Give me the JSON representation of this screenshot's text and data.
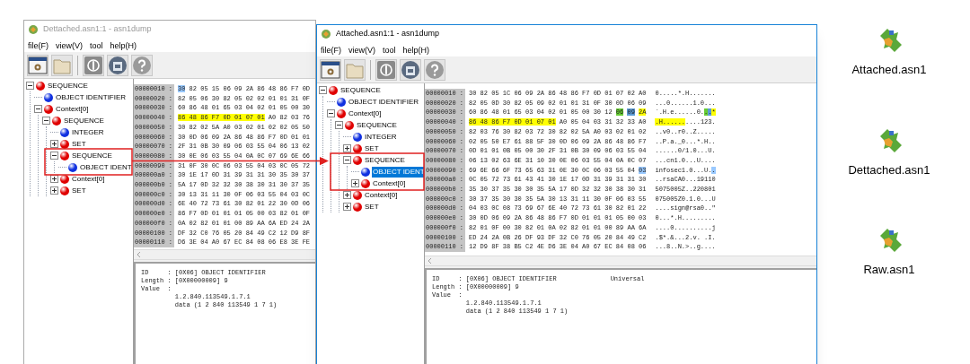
{
  "windows": [
    {
      "title": "Dettached.asn1:1 - asn1dump",
      "active": false,
      "menu": [
        "file(F)",
        "view(V)",
        "tool",
        "help(H)"
      ],
      "tree": [
        {
          "label": "SEQUENCE",
          "color": "#e00000",
          "expanded": true,
          "selected": false,
          "children": [
            {
              "label": "OBJECT IDENTIFIER",
              "color": "#1030e0",
              "selected": false
            },
            {
              "label": "Context[0]",
              "color": "#e00000",
              "expanded": true,
              "selected": false,
              "children": [
                {
                  "label": "SEQUENCE",
                  "color": "#e00000",
                  "expanded": true,
                  "selected": false,
                  "children": [
                    {
                      "label": "INTEGER",
                      "color": "#1030e0",
                      "selected": false
                    },
                    {
                      "label": "SET",
                      "color": "#e00000",
                      "expanded": false,
                      "selected": false
                    },
                    {
                      "label": "SEQUENCE",
                      "color": "#e00000",
                      "expanded": true,
                      "selected": false,
                      "children": [
                        {
                          "label": "OBJECT IDENT",
                          "color": "#1030e0",
                          "selected": false
                        }
                      ]
                    },
                    {
                      "label": "Context[0]",
                      "color": "#e00000",
                      "expanded": false,
                      "selected": false
                    },
                    {
                      "label": "SET",
                      "color": "#e00000",
                      "expanded": false,
                      "selected": false
                    }
                  ]
                }
              ]
            }
          ]
        }
      ],
      "hex_rows": [
        {
          "offset": "00000010 :",
          "hex": [
            {
              "text": "30",
              "color": "#99c9ff"
            },
            {
              "text": " 82 05 15 06 09 2A 86 48 86 F7 0D"
            }
          ]
        },
        {
          "offset": "00000020 :",
          "hex": [
            {
              "text": "82 05 06 30 82 05 02 02 01 01 31 0F"
            }
          ]
        },
        {
          "offset": "00000030 :",
          "hex": [
            {
              "text": "60 86 48 01 65 03 04 02 01 05 00 30"
            }
          ]
        },
        {
          "offset": "00000040 :",
          "hex": [
            {
              "text": "86 48 86 F7 0D 01 07 01",
              "color": "#ffff00"
            },
            {
              "text": " A0 82 03 76"
            }
          ]
        },
        {
          "offset": "00000050 :",
          "hex": [
            {
              "text": "30 82 02 5A A0 03 02 01 02 02 05 50"
            }
          ]
        },
        {
          "offset": "00000060 :",
          "hex": [
            {
              "text": "30 0D 06 09 2A 86 48 86 F7 0D 01 01"
            }
          ]
        },
        {
          "offset": "00000070 :",
          "hex": [
            {
              "text": "2F 31 0B 30 09 06 03 55 04 06 13 02"
            }
          ]
        },
        {
          "offset": "00000080 :",
          "hex": [
            {
              "text": "30 0E 06 03 55 04 0A 0C 07 69 6E 66"
            }
          ]
        },
        {
          "offset": "00000090 :",
          "hex": [
            {
              "text": "31 0F 30 0C 06 03 55 04 03 0C 05 72"
            }
          ]
        },
        {
          "offset": "000000a0 :",
          "hex": [
            {
              "text": "30 1E 17 0D 31 39 31 31 30 35 30 37"
            }
          ]
        },
        {
          "offset": "000000b0 :",
          "hex": [
            {
              "text": "5A 17 0D 32 32 30 38 30 31 30 37 35"
            }
          ]
        },
        {
          "offset": "000000c0 :",
          "hex": [
            {
              "text": "30 13 31 11 30 0F 06 03 55 04 03 0C"
            }
          ]
        },
        {
          "offset": "000000d0 :",
          "hex": [
            {
              "text": "6E 40 72 73 61 30 82 01 22 30 0D 06"
            }
          ]
        },
        {
          "offset": "000000e0 :",
          "hex": [
            {
              "text": "86 F7 0D 01 01 01 05 00 03 82 01 0F"
            }
          ]
        },
        {
          "offset": "000000f0 :",
          "hex": [
            {
              "text": "0A 02 82 01 01 00 89 AA 6A ED 24 2A"
            }
          ]
        },
        {
          "offset": "00000100 :",
          "hex": [
            {
              "text": "DF 32 C0 76 05 20 84 49 C2 12 D9 8F"
            }
          ]
        },
        {
          "offset": "00000110 :",
          "hex": [
            {
              "text": "D6 3E 04 A0 67 EC 84 08 06 E8 3E FE"
            }
          ]
        }
      ],
      "detail": [
        {
          "text": "ID     : [0X06] OBJECT IDENTIFIER"
        },
        {
          "text": "Length : [0X00000009] 9"
        },
        {
          "text": "Value  :"
        },
        {
          "text": "         1.2.840.113549.1.7.1"
        },
        {
          "text": "         data (1 2 840 113549 1 7 1)"
        }
      ]
    },
    {
      "title": "Attached.asn1:1 - asn1dump",
      "active": true,
      "menu": [
        "file(F)",
        "view(V)",
        "tool",
        "help(H)"
      ],
      "tree": [
        {
          "label": "SEQUENCE",
          "color": "#e00000",
          "expanded": true,
          "selected": false,
          "children": [
            {
              "label": "OBJECT IDENTIFIER",
              "color": "#1030e0",
              "selected": false
            },
            {
              "label": "Context[0]",
              "color": "#e00000",
              "expanded": true,
              "selected": false,
              "children": [
                {
                  "label": "SEQUENCE",
                  "color": "#e00000",
                  "expanded": true,
                  "selected": false,
                  "children": [
                    {
                      "label": "INTEGER",
                      "color": "#1030e0",
                      "selected": false
                    },
                    {
                      "label": "SET",
                      "color": "#e00000",
                      "expanded": false,
                      "selected": false
                    },
                    {
                      "label": "SEQUENCE",
                      "color": "#e00000",
                      "expanded": true,
                      "selected": false,
                      "children": [
                        {
                          "label": "OBJECT IDENT",
                          "color": "#1030e0",
                          "selected": true
                        },
                        {
                          "label": "Context[0]",
                          "color": "#e00000",
                          "expanded": false,
                          "selected": false
                        }
                      ]
                    },
                    {
                      "label": "Context[0]",
                      "color": "#e00000",
                      "expanded": false,
                      "selected": false
                    },
                    {
                      "label": "SET",
                      "color": "#e00000",
                      "expanded": false,
                      "selected": false
                    }
                  ]
                }
              ]
            }
          ]
        }
      ],
      "hex_rows": [
        {
          "offset": "00000010 :",
          "hex": [
            {
              "text": "30 82 05 1C 06 09 2A 86 48 86 F7 0D 01 07 02 A0"
            }
          ],
          "ascii": [
            {
              "text": "0.....*.H......."
            }
          ]
        },
        {
          "offset": "00000020 :",
          "hex": [
            {
              "text": "82 05 0D 30 82 05 09 02 01 01 31 0F 30 0D 06 09"
            }
          ],
          "ascii": [
            {
              "text": "...0......1.0..."
            }
          ]
        },
        {
          "offset": "00000030 :",
          "hex": [
            {
              "text": "60 86 48 01 65 03 04 02 01 05 00 30 12 "
            },
            {
              "text": "06",
              "color": "#66cc33"
            },
            {
              "text": "09",
              "color": "#5b9bd5"
            },
            {
              "text": "2A",
              "color": "#ffff00"
            }
          ],
          "ascii": [
            {
              "text": "`.H.e......0."
            },
            {
              "text": ".",
              "color": "#66cc33"
            },
            {
              "text": ".",
              "color": "#5b9bd5"
            },
            {
              "text": "*",
              "color": "#ffff00"
            }
          ]
        },
        {
          "offset": "00000040 :",
          "hex": [
            {
              "text": "86 48 86 F7 0D 01 07 01",
              "color": "#ffff00"
            },
            {
              "text": " A0 05 04 03 31 32 33 A0"
            }
          ],
          "ascii": [
            {
              "text": ".H......",
              "color": "#ffff00"
            },
            {
              "text": "....123."
            }
          ]
        },
        {
          "offset": "00000050 :",
          "hex": [
            {
              "text": "82 03 76 30 82 03 72 30 82 02 5A A0 03 02 01 02"
            }
          ],
          "ascii": [
            {
              "text": "..v0..r0..Z....."
            }
          ]
        },
        {
          "offset": "00000060 :",
          "hex": [
            {
              "text": "02 05 50 E7 61 88 5F 30 0D 06 09 2A 86 48 86 F7"
            }
          ],
          "ascii": [
            {
              "text": "..P.a._0...*.H.."
            }
          ]
        },
        {
          "offset": "00000070 :",
          "hex": [
            {
              "text": "0D 01 01 0B 05 00 30 2F 31 0B 30 09 06 03 55 04"
            }
          ],
          "ascii": [
            {
              "text": "......0/1.0...U."
            }
          ]
        },
        {
          "offset": "00000080 :",
          "hex": [
            {
              "text": "06 13 02 63 6E 31 10 30 0E 06 03 55 04 0A 0C 07"
            }
          ],
          "ascii": [
            {
              "text": "...cn1.0...U...."
            }
          ]
        },
        {
          "offset": "00000090 :",
          "hex": [
            {
              "text": "69 6E 66 6F 73 65 63 31 0E 30 0C 06 03 55 04 "
            },
            {
              "text": "03",
              "color": "#99c9ff"
            }
          ],
          "ascii": [
            {
              "text": "infosec1.0...U."
            },
            {
              "text": ".",
              "color": "#99c9ff"
            }
          ]
        },
        {
          "offset": "000000a0 :",
          "hex": [
            {
              "text": "0C 05 72 73 61 43 41 30 1E 17 0D 31 39 31 31 30"
            }
          ],
          "ascii": [
            {
              "text": "..rsaCA0...19110"
            }
          ]
        },
        {
          "offset": "000000b0 :",
          "hex": [
            {
              "text": "35 30 37 35 30 30 35 5A 17 0D 32 32 30 38 30 31"
            }
          ],
          "ascii": [
            {
              "text": "5075005Z..220801"
            }
          ]
        },
        {
          "offset": "000000c0 :",
          "hex": [
            {
              "text": "30 37 35 30 30 35 5A 30 13 31 11 30 0F 06 03 55"
            }
          ],
          "ascii": [
            {
              "text": "075005Z0.1.0...U"
            }
          ]
        },
        {
          "offset": "000000d0 :",
          "hex": [
            {
              "text": "04 03 0C 08 73 69 67 6E 40 72 73 61 30 82 01 22"
            }
          ],
          "ascii": [
            {
              "text": "....sign@rsa0..\""
            }
          ]
        },
        {
          "offset": "000000e0 :",
          "hex": [
            {
              "text": "30 0D 06 09 2A 86 48 86 F7 0D 01 01 01 05 00 03"
            }
          ],
          "ascii": [
            {
              "text": "0...*.H........."
            }
          ]
        },
        {
          "offset": "000000f0 :",
          "hex": [
            {
              "text": "82 01 0F 00 30 82 01 0A 02 82 01 01 00 89 AA 6A"
            }
          ],
          "ascii": [
            {
              "text": "....0..........j"
            }
          ]
        },
        {
          "offset": "00000100 :",
          "hex": [
            {
              "text": "ED 24 2A 0B 26 DF 93 DF 32 C0 76 05 20 84 49 C2"
            }
          ],
          "ascii": [
            {
              "text": ".$*.&...2.v. .I."
            }
          ]
        },
        {
          "offset": "00000110 :",
          "hex": [
            {
              "text": "12 D9 8F 38 B5 C2 4E D6 3E 04 A0 67 EC 84 08 06"
            }
          ],
          "ascii": [
            {
              "text": "...8..N.>..g...."
            }
          ]
        }
      ],
      "detail": [
        {
          "text": "ID     : [0X06] OBJECT IDENTIFIER",
          "note": "Universal"
        },
        {
          "text": "Length : [0X00000009] 9"
        },
        {
          "text": "Value  :"
        },
        {
          "text": "         1.2.840.113549.1.7.1"
        },
        {
          "text": "         data (1 2 840 113549 1 7 1)"
        }
      ]
    }
  ],
  "desktop_icons": [
    {
      "label": "Attached.asn1"
    },
    {
      "label": "Dettached.asn1"
    },
    {
      "label": "Raw.asn1"
    }
  ]
}
